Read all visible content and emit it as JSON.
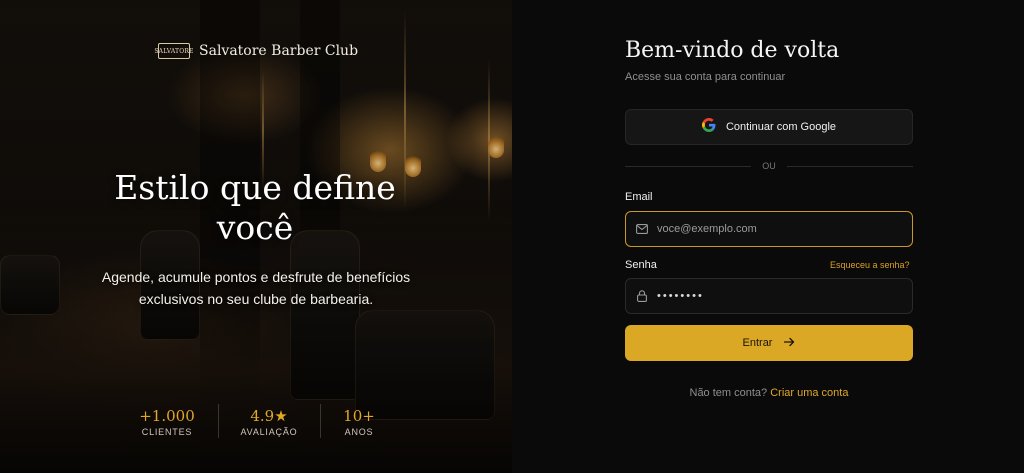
{
  "hero": {
    "brand_name": "Salvatore Barber Club",
    "logo_text": "SALVATORE",
    "headline_line1": "Estilo que define",
    "headline_line2": "você",
    "subline_line1": "Agende, acumule pontos e desfrute de benefícios",
    "subline_line2": "exclusivos no seu clube de barbearia.",
    "stats": [
      {
        "value": "+1.000",
        "label": "CLIENTES"
      },
      {
        "value": "4.9★",
        "label": "AVALIAÇÃO"
      },
      {
        "value": "10+",
        "label": "ANOS"
      }
    ]
  },
  "form": {
    "title": "Bem-vindo de volta",
    "subtitle": "Acesse sua conta para continuar",
    "google_label": "Continuar com Google",
    "divider_text": "OU",
    "email_label": "Email",
    "email_placeholder": "voce@exemplo.com",
    "password_label": "Senha",
    "forgot_label": "Esqueceu a senha?",
    "password_value": "••••••••",
    "submit_label": "Entrar",
    "signup_prompt": "Não tem conta?",
    "signup_link": "Criar uma conta"
  },
  "colors": {
    "accent": "#dba826",
    "background": "#0a0a0a",
    "input_bg": "#0f0f0f"
  },
  "icons": [
    "google-icon",
    "mail-icon",
    "lock-icon",
    "arrow-right-icon"
  ]
}
